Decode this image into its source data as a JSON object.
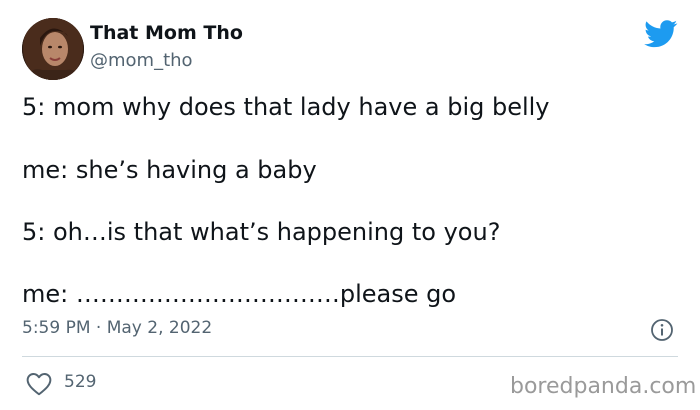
{
  "author": {
    "display_name": "That Mom Tho",
    "handle": "@mom_tho"
  },
  "icons": {
    "twitter_logo": "twitter-bird-icon",
    "info": "info-circle-icon",
    "like": "heart-outline-icon"
  },
  "colors": {
    "twitter_blue": "#1d9bf0",
    "text": "#0f1419",
    "muted": "#536471"
  },
  "tweet": {
    "lines": [
      "5: mom why does that lady have a big belly",
      "me: she’s having a baby",
      "5: oh…is that what’s happening to you?",
      "me: ……………………………please go"
    ],
    "timestamp": "5:59 PM · May 2, 2022",
    "likes": "529"
  },
  "watermark": "boredpanda.com"
}
